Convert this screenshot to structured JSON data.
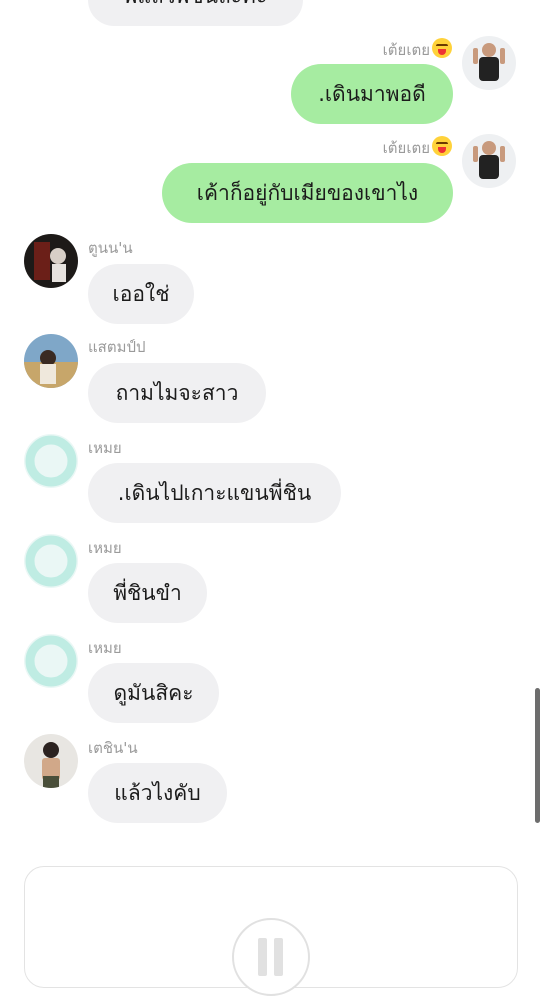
{
  "messages": [
    {
      "sender": "",
      "text": "พี่แล้วพี่ชินล่ะคะ",
      "outgoing": false
    },
    {
      "sender": "เต้ยเตย",
      "text": ".เดินมาพอดี",
      "outgoing": true
    },
    {
      "sender": "เต้ยเตย",
      "text": "เค้าก็อยู่กับเมียของเขาไง",
      "outgoing": true
    },
    {
      "sender": "ตูนน'น",
      "text": "เออใช่",
      "outgoing": false
    },
    {
      "sender": "แสตมป์ป",
      "text": "ถามไมจะสาว",
      "outgoing": false
    },
    {
      "sender": "เหมย",
      "text": ".เดินไปเกาะแขนพี่ชิน",
      "outgoing": false
    },
    {
      "sender": "เหมย",
      "text": "พี่ชินขำ",
      "outgoing": false
    },
    {
      "sender": "เหมย",
      "text": "ดูมันสิคะ",
      "outgoing": false
    },
    {
      "sender": "เตชิน'น",
      "text": "แล้วไงคับ",
      "outgoing": false
    }
  ],
  "icons": {
    "sender_emoji": "squinting-tongue-face-icon",
    "default_avatar": "default-avatar-icon",
    "pause": "pause-icon"
  },
  "colors": {
    "incoming_bubble": "#f0f0f2",
    "outgoing_bubble": "#a6eca1",
    "name_text": "#9a9a9a"
  }
}
